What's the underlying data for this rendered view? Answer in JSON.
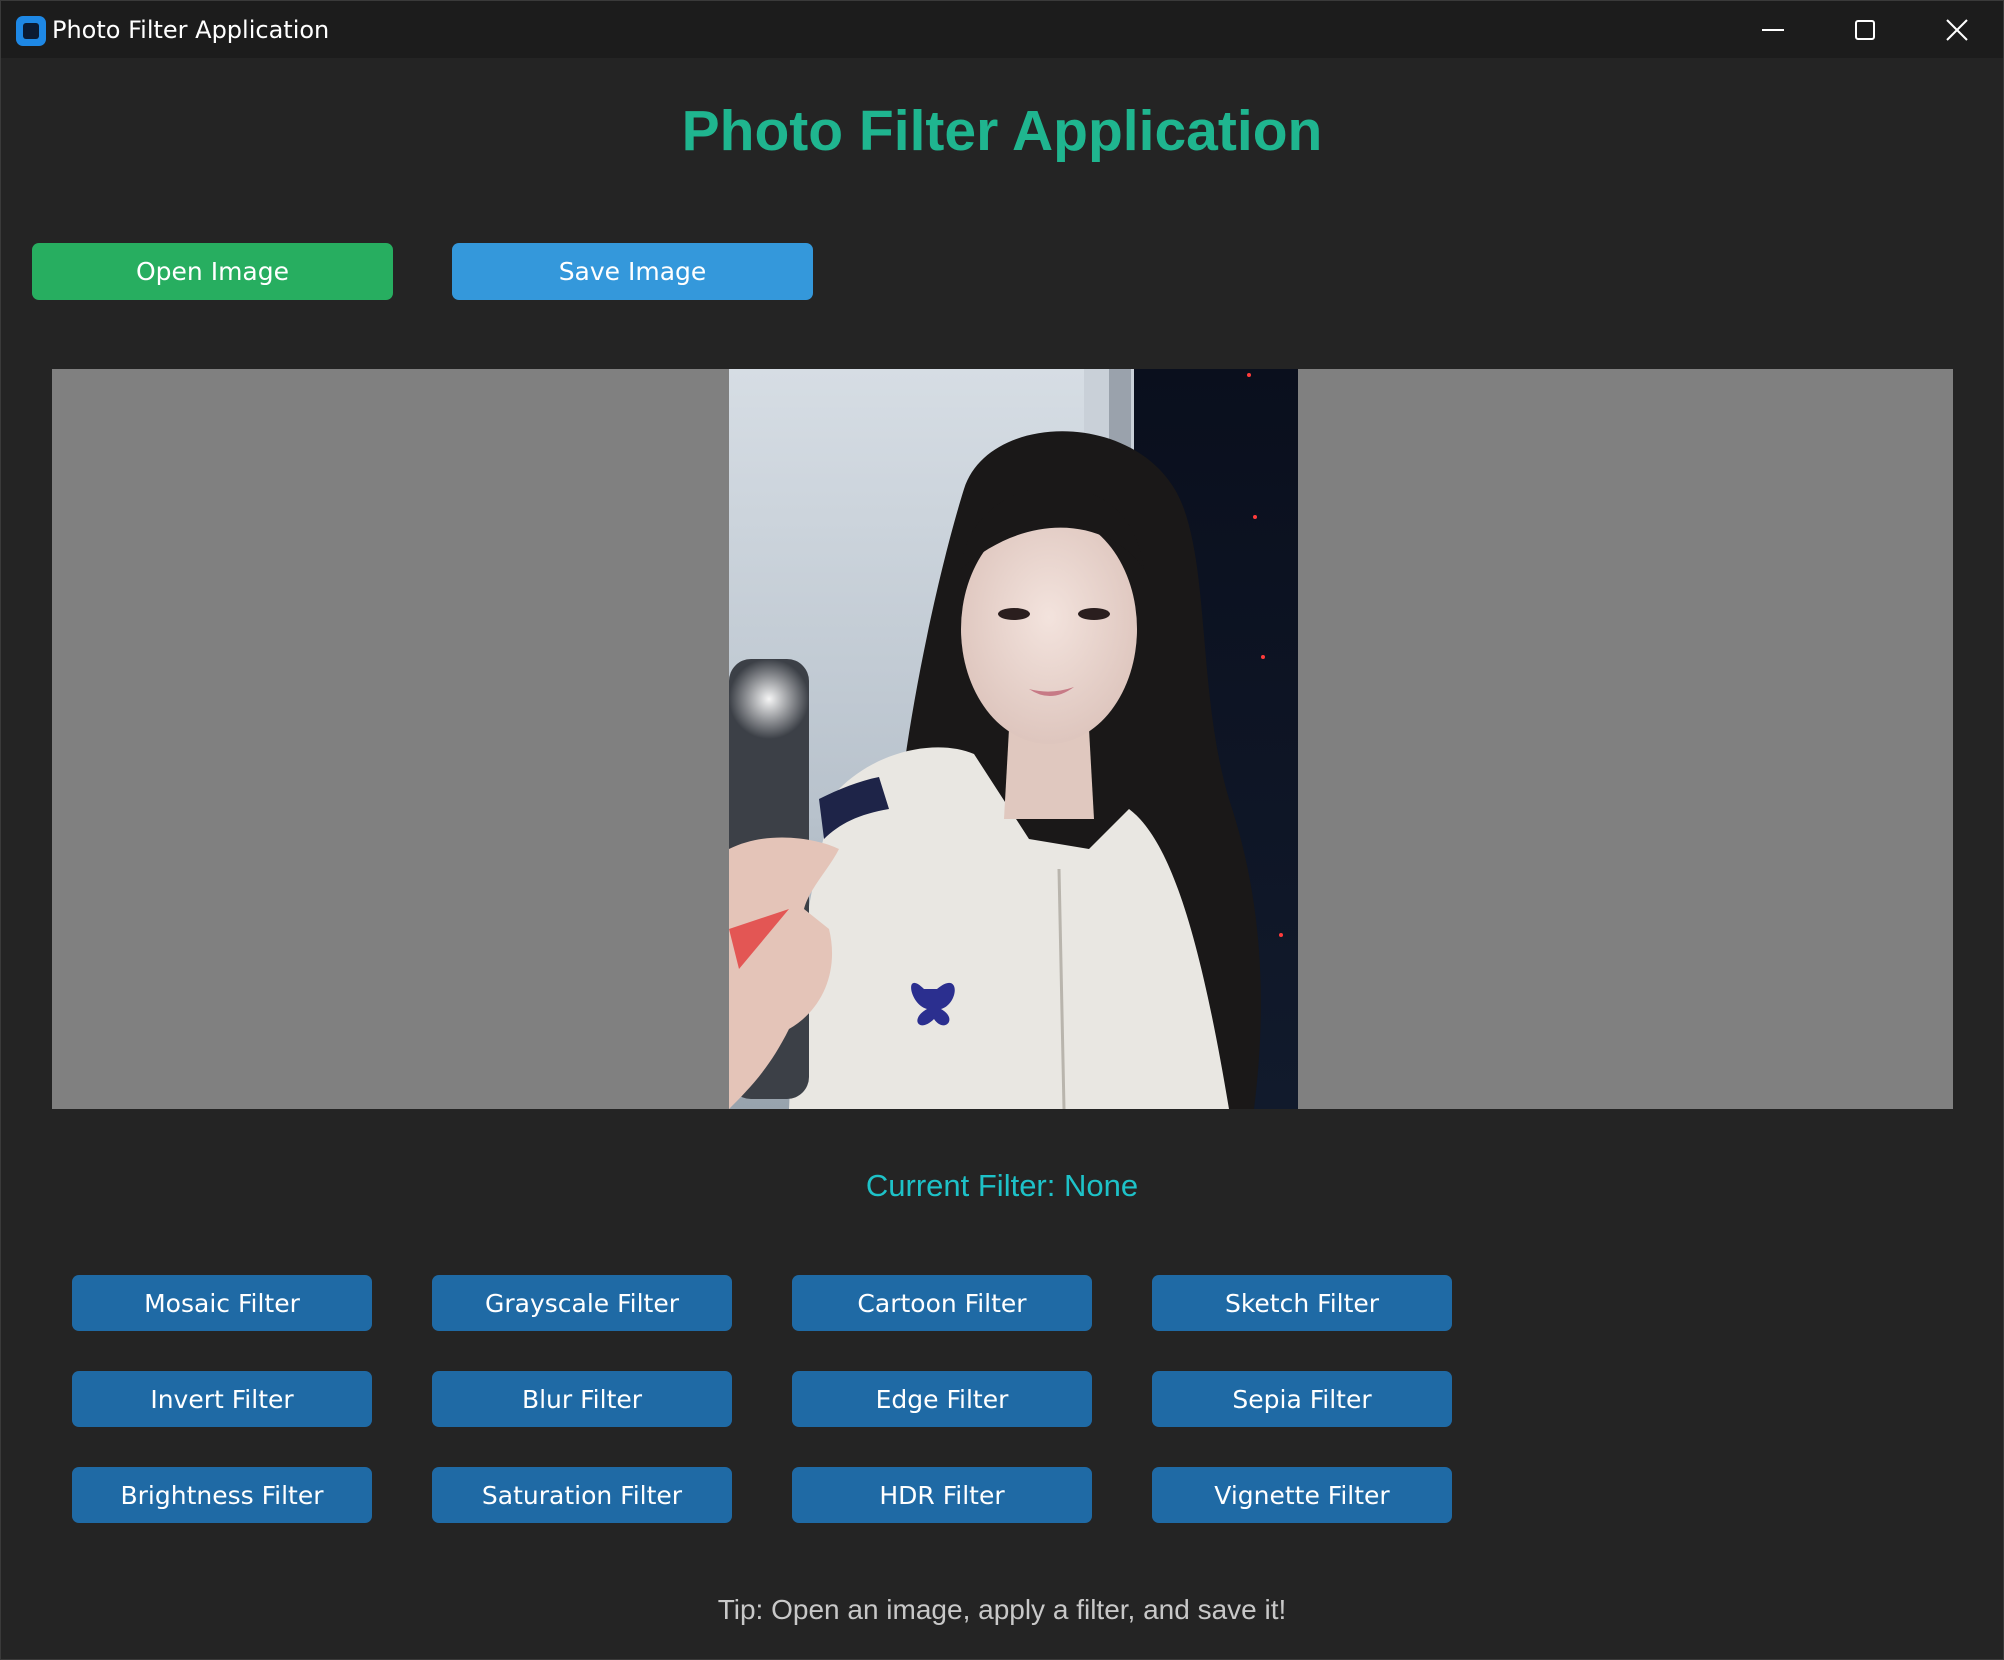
{
  "window": {
    "title": "Photo Filter Application"
  },
  "header": {
    "title": "Photo Filter Application"
  },
  "toolbar": {
    "open_label": "Open Image",
    "save_label": "Save Image"
  },
  "status": {
    "current_filter": "Current Filter: None"
  },
  "filters": [
    {
      "label": "Mosaic Filter"
    },
    {
      "label": "Grayscale Filter"
    },
    {
      "label": "Cartoon Filter"
    },
    {
      "label": "Sketch Filter"
    },
    {
      "label": "Invert Filter"
    },
    {
      "label": "Blur Filter"
    },
    {
      "label": "Edge Filter"
    },
    {
      "label": "Sepia Filter"
    },
    {
      "label": "Brightness Filter"
    },
    {
      "label": "Saturation Filter"
    },
    {
      "label": "HDR Filter"
    },
    {
      "label": "Vignette Filter"
    }
  ],
  "footer": {
    "tip": "Tip: Open an image, apply a filter, and save it!"
  },
  "colors": {
    "title": "#1fb58f",
    "open_button": "#27ae60",
    "save_button": "#3498db",
    "filter_button": "#1f6aa5",
    "status_text": "#1ec2c8",
    "background": "#242424",
    "canvas": "#808080"
  },
  "icons": {
    "app": "app-icon",
    "minimize": "minimize-icon",
    "maximize": "maximize-icon",
    "close": "close-icon"
  }
}
